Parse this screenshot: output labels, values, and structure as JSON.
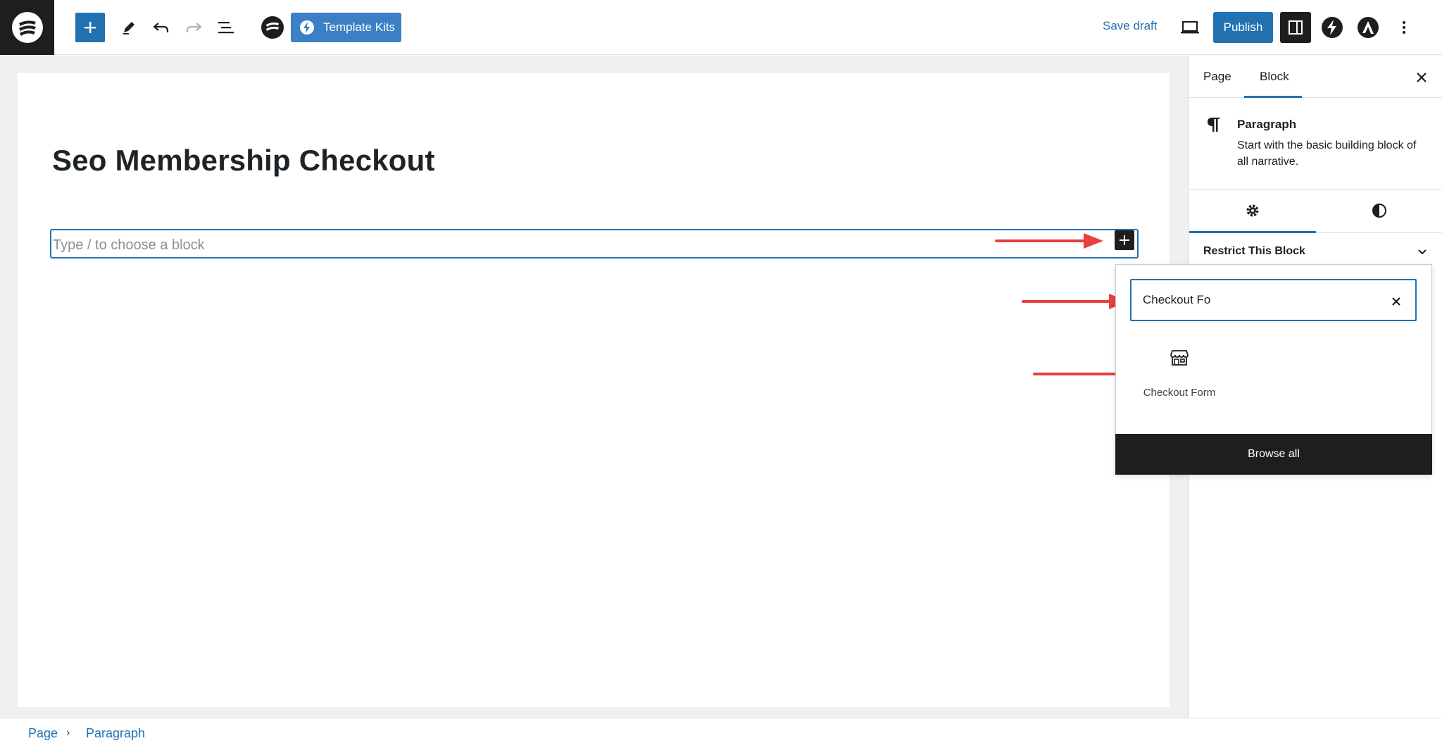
{
  "toolbar": {
    "template_kits_label": "Template Kits",
    "save_draft_label": "Save draft",
    "publish_label": "Publish"
  },
  "editor": {
    "post_title": "Seo Membership Checkout",
    "block_placeholder": "Type / to choose a block"
  },
  "sidebar": {
    "tabs": [
      {
        "label": "Page"
      },
      {
        "label": "Block",
        "active": true
      }
    ],
    "block_card": {
      "title": "Paragraph",
      "description": "Start with the basic building block of all narrative."
    },
    "restrict_label": "Restrict This Block"
  },
  "inserter": {
    "search_value": "Checkout Fo",
    "results": [
      {
        "label": "Checkout Form",
        "icon": "store-icon"
      }
    ],
    "browse_all_label": "Browse all"
  },
  "breadcrumb": {
    "items": [
      "Page",
      "Paragraph"
    ]
  },
  "colors": {
    "accent": "#2271b1",
    "dark": "#1e1e1e",
    "annotation_arrow": "#e8403f"
  }
}
